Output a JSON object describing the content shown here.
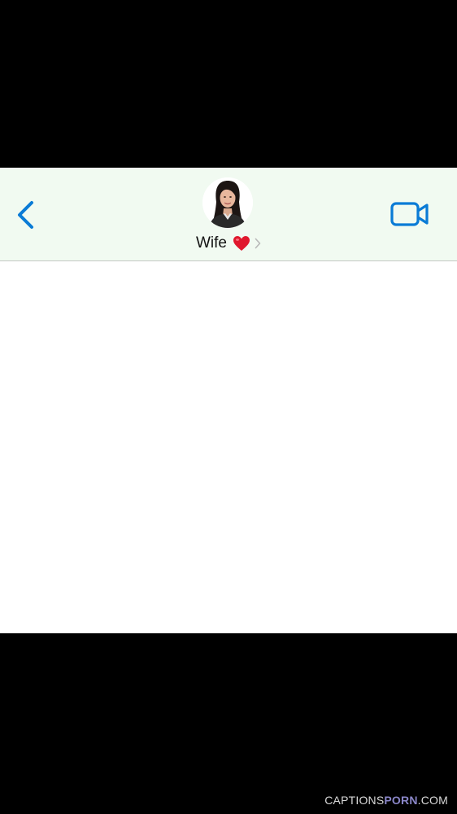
{
  "header": {
    "contact_name": "Wife",
    "back_icon": "chevron-left-icon",
    "heart_icon": "red-heart-emoji",
    "disclosure_icon": "chevron-right-icon",
    "video_icon": "video-camera-icon"
  },
  "colors": {
    "accent": "#0a7bd6",
    "header_background": "#f1faf1",
    "heart": "#e0182d",
    "letterbox": "#000000"
  },
  "watermark": {
    "part1": "CAPTIONS",
    "part2": "PORN",
    "part3": ".COM"
  }
}
